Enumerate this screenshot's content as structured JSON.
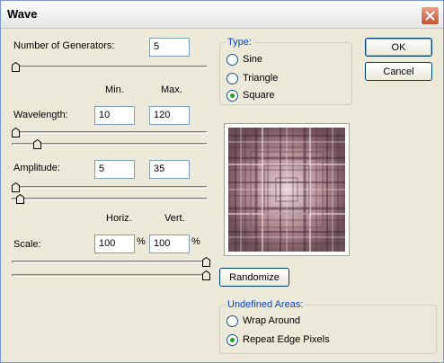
{
  "window": {
    "title": "Wave"
  },
  "generators": {
    "label": "Number of Generators:",
    "value": "5"
  },
  "columns": {
    "min": "Min.",
    "max": "Max.",
    "horiz": "Horiz.",
    "vert": "Vert."
  },
  "wavelength": {
    "label": "Wavelength:",
    "min": "10",
    "max": "120",
    "slider_min_level": 0.0,
    "slider_max_level": 0.12
  },
  "amplitude": {
    "label": "Amplitude:",
    "min": "5",
    "max": "35",
    "slider_min_level": 0.0,
    "slider_max_level": 0.03
  },
  "scale": {
    "label": "Scale:",
    "horiz": "100",
    "vert": "100",
    "unit": "%",
    "slider_h_level": 1.0,
    "slider_v_level": 1.0
  },
  "type_group": {
    "legend": "Type:",
    "options": [
      "Sine",
      "Triangle",
      "Square"
    ],
    "selected": "Square"
  },
  "undefined_group": {
    "legend": "Undefined Areas:",
    "options": [
      "Wrap Around",
      "Repeat Edge Pixels"
    ],
    "selected": "Repeat Edge Pixels"
  },
  "buttons": {
    "ok": "OK",
    "cancel": "Cancel",
    "randomize": "Randomize"
  },
  "colors": {
    "accent": "#0046d5",
    "face": "#ece9d8",
    "preview_base": "#b48c96"
  }
}
